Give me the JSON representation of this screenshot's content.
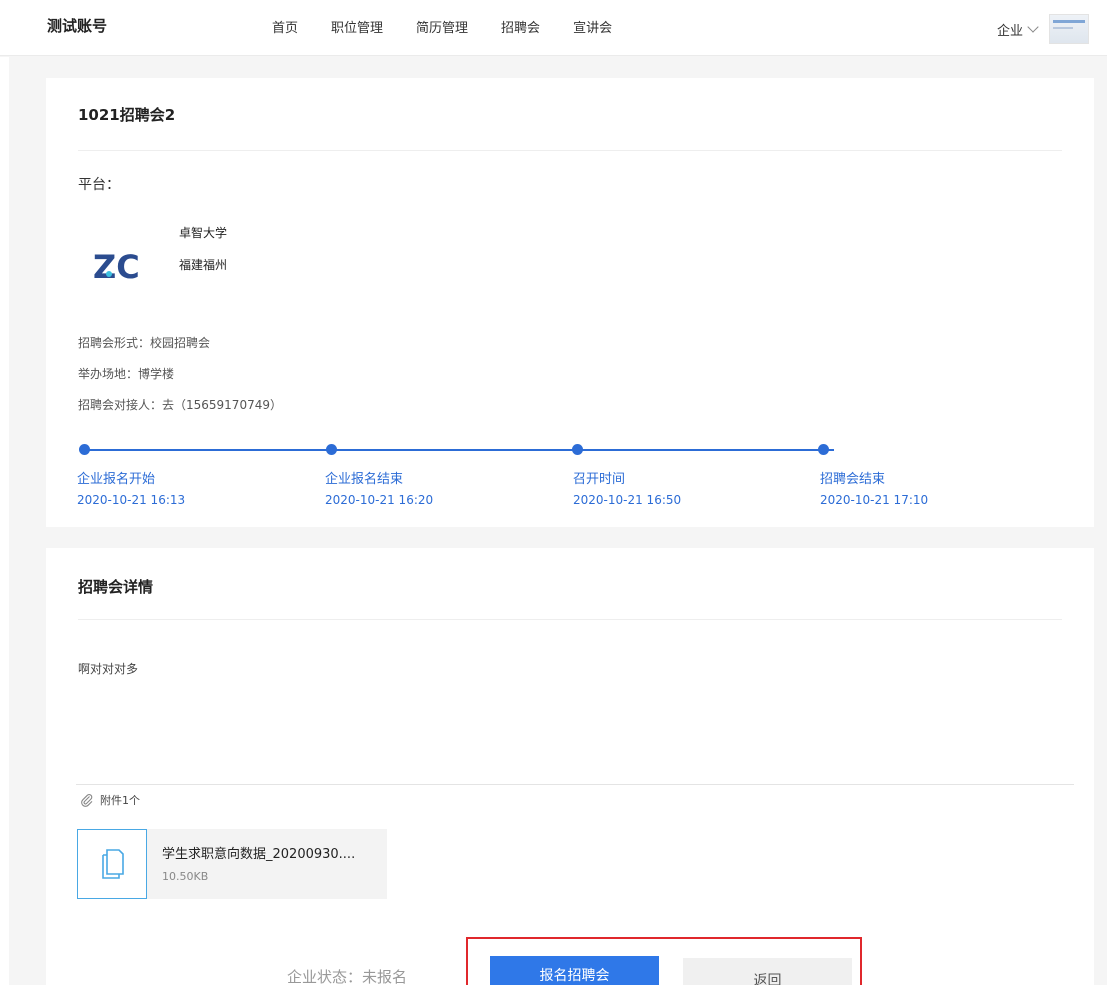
{
  "header": {
    "brand": "测试账号",
    "nav": [
      "首页",
      "职位管理",
      "简历管理",
      "招聘会",
      "宣讲会"
    ],
    "role": "企业"
  },
  "fair": {
    "title": "1021招聘会2",
    "platform_label": "平台：",
    "university": {
      "name": "卓智大学",
      "location": "福建福州",
      "logo_text": "ZC"
    },
    "info": [
      "招聘会形式：校园招聘会",
      "举办场地：博学楼",
      "招聘会对接人：去（15659170749）"
    ],
    "timeline": [
      {
        "label": "企业报名开始",
        "time": "2020-10-21 16:13"
      },
      {
        "label": "企业报名结束",
        "time": "2020-10-21 16:20"
      },
      {
        "label": "召开时间",
        "time": "2020-10-21 16:50"
      },
      {
        "label": "招聘会结束",
        "time": "2020-10-21 17:10"
      }
    ]
  },
  "details": {
    "title": "招聘会详情",
    "text": "啊对对对多",
    "attachment_header": "附件1个",
    "file": {
      "name": "学生求职意向数据_20200930....",
      "size": "10.50KB"
    }
  },
  "footer": {
    "status": "企业状态：未报名",
    "register_label": "报名招聘会",
    "back_label": "返回"
  },
  "colors": {
    "accent": "#2c6cd6",
    "button_blue": "#2f78e8",
    "highlight_red": "#e0282c"
  }
}
